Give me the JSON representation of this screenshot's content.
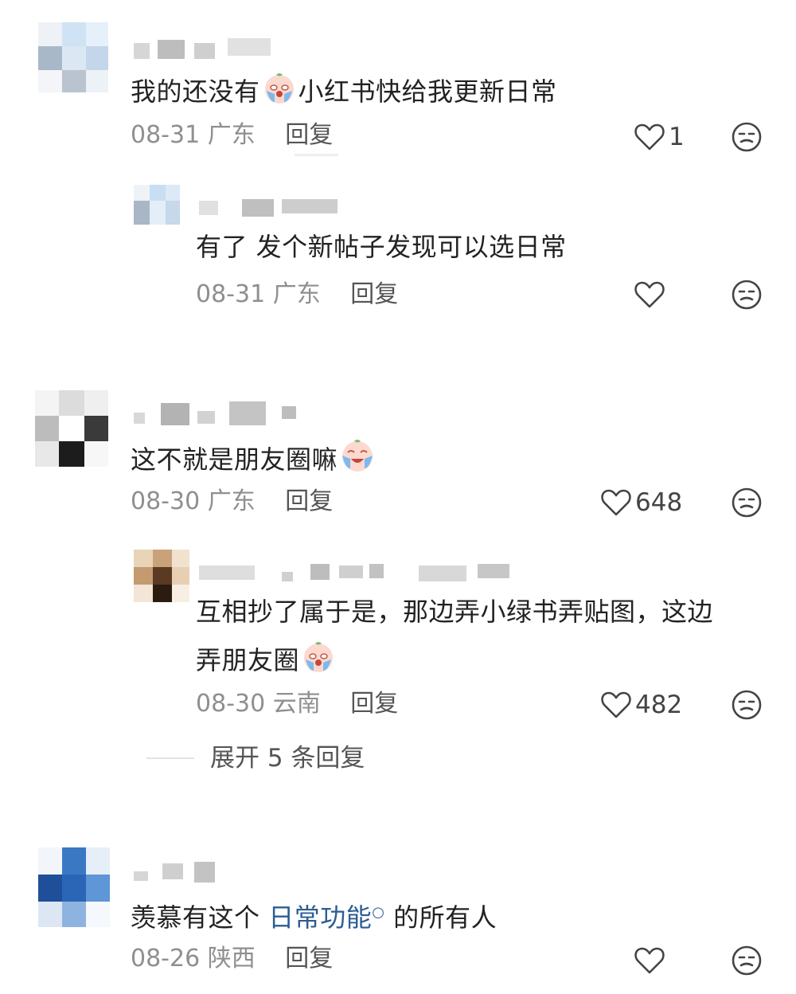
{
  "comments": [
    {
      "text": "我的还没有",
      "text_after_emoji": "小红书快给我更新日常",
      "emoji": "crying-face-emoji",
      "date": "08-31",
      "location": "广东",
      "reply_label": "回复",
      "likes": "1",
      "replies": [
        {
          "text": "有了 发个新帖子发现可以选日常",
          "date": "08-31",
          "location": "广东",
          "reply_label": "回复",
          "likes": ""
        }
      ]
    },
    {
      "text": "这不就是朋友圈嘛",
      "emoji": "laughing-crying-emoji",
      "date": "08-30",
      "location": "广东",
      "reply_label": "回复",
      "likes": "648",
      "replies": [
        {
          "text_line1": "互相抄了属于是，那边弄小绿书弄贴图，这边",
          "text_line2": "弄朋友圈",
          "emoji": "crying-face-emoji",
          "date": "08-30",
          "location": "云南",
          "reply_label": "回复",
          "likes": "482"
        }
      ],
      "expand_label": "展开 5 条回复"
    },
    {
      "text_before_link": "羡慕有这个 ",
      "link_text": "日常功能",
      "text_after_link": " 的所有人",
      "date": "08-26",
      "location": "陕西",
      "reply_label": "回复",
      "likes": ""
    }
  ],
  "colors": {
    "text": "#222222",
    "meta": "#8f8f8f",
    "link": "#2d5c94"
  }
}
